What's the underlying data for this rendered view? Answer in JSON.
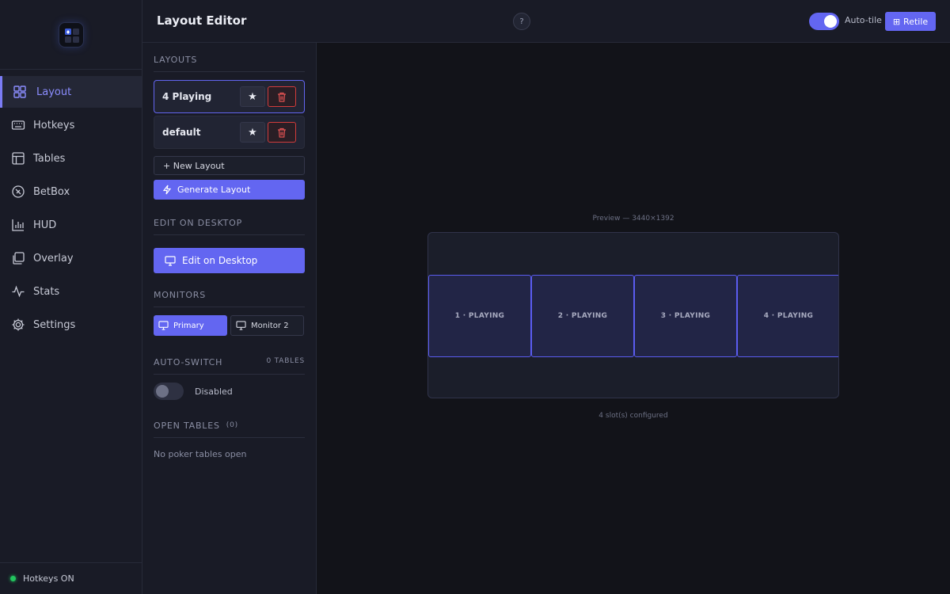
{
  "header": {
    "title": "Layout Editor",
    "help_label": "?",
    "auto_tile_label": "Auto-tile",
    "retile_label": "Retile"
  },
  "sidebar": {
    "items": [
      {
        "label": "Layout",
        "icon": "grid-icon",
        "active": true
      },
      {
        "label": "Hotkeys",
        "icon": "keyboard-icon"
      },
      {
        "label": "Tables",
        "icon": "table-icon"
      },
      {
        "label": "BetBox",
        "icon": "chip-icon"
      },
      {
        "label": "HUD",
        "icon": "bar-chart-icon"
      },
      {
        "label": "Overlay",
        "icon": "layers-icon"
      },
      {
        "label": "Stats",
        "icon": "activity-icon"
      },
      {
        "label": "Settings",
        "icon": "gear-icon"
      }
    ],
    "status": "Hotkeys ON"
  },
  "panel": {
    "layouts": {
      "heading": "LAYOUTS",
      "items": [
        {
          "name": "4 Playing",
          "selected": true
        },
        {
          "name": "default",
          "selected": false
        }
      ],
      "new_label": "+ New Layout",
      "generate_label": "Generate Layout"
    },
    "desktop": {
      "heading": "EDIT ON DESKTOP",
      "button_label": "Edit on Desktop"
    },
    "monitors": {
      "heading": "MONITORS",
      "items": [
        "Primary",
        "Monitor 2"
      ]
    },
    "auto_switch": {
      "heading": "AUTO-SWITCH",
      "count": "0 TABLES",
      "state": "Disabled"
    },
    "open_tables": {
      "heading": "OPEN TABLES",
      "count": "(0)",
      "empty": "No poker tables open"
    }
  },
  "preview": {
    "label": "Preview — 3440×1392",
    "slots": [
      "1 · PLAYING",
      "2 · PLAYING",
      "3 · PLAYING",
      "4 · PLAYING"
    ],
    "summary": "4 slot(s) configured"
  },
  "colors": {
    "accent": "#6366f1",
    "danger": "#d23c3c",
    "status_on": "#22c55e",
    "background": "#121319",
    "panel": "#191b26"
  }
}
